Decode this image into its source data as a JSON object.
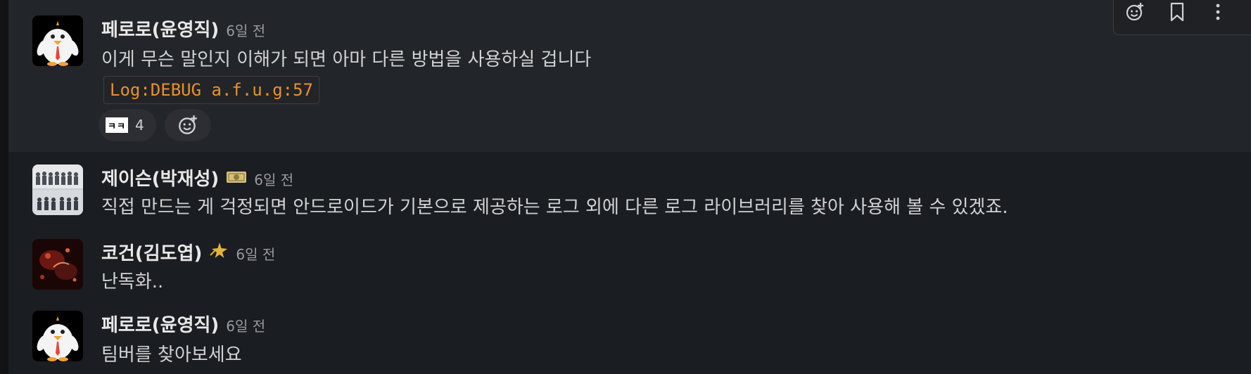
{
  "messages": [
    {
      "username": "페로로(윤영직)",
      "time": "6일 전",
      "text": "이게 무슨 말인지 이해가 되면 아마 다른 방법을 사용하실 겁니다",
      "code": "Log:DEBUG a.f.u.g:57",
      "reactions": [
        {
          "emoji": "ㅋㅋ",
          "count": "4"
        }
      ]
    },
    {
      "username": "제이슨(박재성)",
      "time": "6일 전",
      "status_emoji": "money-icon",
      "text": "직접 만드는 게 걱정되면 안드로이드가 기본으로 제공하는 로그 외에 다른 로그 라이브러리를 찾아 사용해 볼 수 있겠죠."
    },
    {
      "username": "코건(김도엽)",
      "time": "6일 전",
      "status_emoji": "sparkle-star-icon",
      "text": "난독화.."
    },
    {
      "username": "페로로(윤영직)",
      "time": "6일 전",
      "text": "팀버를 찾아보세요"
    }
  ],
  "toolbar": {
    "icons": [
      "add-reaction-icon",
      "bookmark-icon",
      "more-vertical-icon"
    ]
  },
  "colors": {
    "background": "#1a1d21",
    "hover": "#222529",
    "code_text": "#e8912d",
    "username": "#e8e8e8",
    "timestamp": "#9a9b9d"
  }
}
